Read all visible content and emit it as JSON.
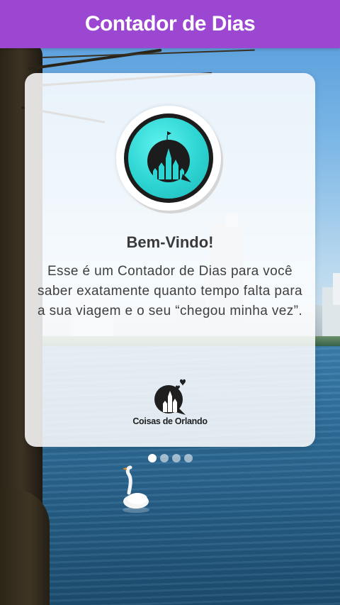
{
  "header": {
    "title": "Contador de Dias",
    "color": "#9b47d2"
  },
  "welcome_card": {
    "title": "Bem-Vindo!",
    "body": "Esse é um Contador de Dias para você saber exatamente quanto tempo falta para a sua viagem e o seu “chegou minha vez”.",
    "logo_icon": "castle-badge-icon",
    "brand_name": "Coisas de Orlando",
    "brand_icon": "castle-hearts-icon",
    "accent_color": "#2cd4d2"
  },
  "pager": {
    "page_count": 4,
    "active_index": 0
  }
}
